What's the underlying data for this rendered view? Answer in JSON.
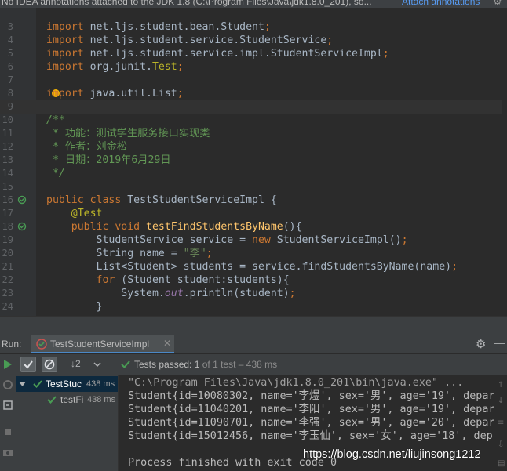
{
  "notification": {
    "message": "No IDEA annotations attached to the JDK 1.8 (C:\\Program Files\\Java\\jdk1.8.0_201), so...",
    "link": "Attach annotations"
  },
  "editor": {
    "lines": [
      {
        "num": "3",
        "current": false,
        "parts": [
          {
            "t": "import",
            "c": "kw"
          },
          {
            "t": " net.ljs.student.bean.Student"
          },
          {
            "t": ";",
            "c": "kw"
          }
        ]
      },
      {
        "num": "4",
        "current": false,
        "parts": [
          {
            "t": "import",
            "c": "kw"
          },
          {
            "t": " net.ljs.student.service.StudentService"
          },
          {
            "t": ";",
            "c": "kw"
          }
        ]
      },
      {
        "num": "5",
        "current": false,
        "parts": [
          {
            "t": "import",
            "c": "kw"
          },
          {
            "t": " net.ljs.student.service.impl.StudentServiceImpl"
          },
          {
            "t": ";",
            "c": "kw"
          }
        ]
      },
      {
        "num": "6",
        "current": false,
        "parts": [
          {
            "t": "import",
            "c": "kw"
          },
          {
            "t": " org.junit."
          },
          {
            "t": "Test",
            "c": "ann"
          },
          {
            "t": ";",
            "c": "kw"
          }
        ]
      },
      {
        "num": "7",
        "current": false,
        "parts": []
      },
      {
        "num": "8",
        "current": false,
        "bulb": true,
        "parts": [
          {
            "t": "import",
            "c": "kw"
          },
          {
            "t": " java.util.List"
          },
          {
            "t": ";",
            "c": "kw"
          }
        ]
      },
      {
        "num": "9",
        "current": true,
        "parts": []
      },
      {
        "num": "10",
        "current": false,
        "parts": [
          {
            "t": "/**",
            "c": "cm"
          }
        ]
      },
      {
        "num": "11",
        "current": false,
        "parts": [
          {
            "t": " * 功能：测试学生服务接口实现类",
            "c": "cmz"
          }
        ]
      },
      {
        "num": "12",
        "current": false,
        "parts": [
          {
            "t": " * 作者：刘金松",
            "c": "cmz"
          }
        ]
      },
      {
        "num": "13",
        "current": false,
        "parts": [
          {
            "t": " * 日期：2019年6月29日",
            "c": "cmz"
          }
        ]
      },
      {
        "num": "14",
        "current": false,
        "parts": [
          {
            "t": " */",
            "c": "cm"
          }
        ]
      },
      {
        "num": "15",
        "current": false,
        "parts": []
      },
      {
        "num": "16",
        "current": false,
        "runIcon": true,
        "parts": [
          {
            "t": "public class ",
            "c": "kw"
          },
          {
            "t": "TestStudentServiceImpl {"
          }
        ]
      },
      {
        "num": "17",
        "current": false,
        "parts": [
          {
            "t": "    "
          },
          {
            "t": "@Test",
            "c": "ann"
          }
        ]
      },
      {
        "num": "18",
        "current": false,
        "runIcon": true,
        "parts": [
          {
            "t": "    "
          },
          {
            "t": "public void ",
            "c": "kw"
          },
          {
            "t": "testFindStudentsByName",
            "c": "fn"
          },
          {
            "t": "(){"
          }
        ]
      },
      {
        "num": "19",
        "current": false,
        "parts": [
          {
            "t": "        StudentService service = "
          },
          {
            "t": "new ",
            "c": "kw"
          },
          {
            "t": "StudentServiceImpl()"
          },
          {
            "t": ";",
            "c": "kw"
          }
        ]
      },
      {
        "num": "20",
        "current": false,
        "parts": [
          {
            "t": "        String name = "
          },
          {
            "t": "\"李\"",
            "c": "str"
          },
          {
            "t": ";",
            "c": "kw"
          }
        ]
      },
      {
        "num": "21",
        "current": false,
        "parts": [
          {
            "t": "        List<Student> students = service.findStudentsByName(name)"
          },
          {
            "t": ";",
            "c": "kw"
          }
        ]
      },
      {
        "num": "22",
        "current": false,
        "parts": [
          {
            "t": "        "
          },
          {
            "t": "for ",
            "c": "kw"
          },
          {
            "t": "(Student student:students){"
          }
        ]
      },
      {
        "num": "23",
        "current": false,
        "parts": [
          {
            "t": "            System."
          },
          {
            "t": "out",
            "c": "fld"
          },
          {
            "t": ".println(student)"
          },
          {
            "t": ";",
            "c": "kw"
          }
        ]
      },
      {
        "num": "24",
        "current": false,
        "parts": [
          {
            "t": "        }"
          }
        ]
      }
    ]
  },
  "run": {
    "label": "Run:",
    "tab_label": "TestStudentServiceImpl",
    "status_prefix": "Tests passed:",
    "status_count": "1",
    "status_suffix": "of 1 test – 438 ms",
    "sort_label": "↓2"
  },
  "tree": {
    "items": [
      {
        "label": "TestStuc",
        "time": "438 ms",
        "selected": true
      },
      {
        "label": "testFi",
        "time": "438 ms",
        "selected": false
      }
    ]
  },
  "console": {
    "lines": [
      {
        "text": "\"C:\\Program Files\\Java\\jdk1.8.0_201\\bin\\java.exe\" ...",
        "gray": true
      },
      {
        "text": "Student{id=10080302, name='李煜', sex='男', age='19', depar",
        "gray": false
      },
      {
        "text": "Student{id=11040201, name='李阳', sex='男', age='19', depar",
        "gray": false
      },
      {
        "text": "Student{id=11090701, name='李强', sex='男', age='20', depar",
        "gray": false
      },
      {
        "text": "Student{id=15012456, name='李玉仙', sex='女', age='18', dep",
        "gray": false
      },
      {
        "text": "",
        "gray": false
      },
      {
        "text": "Process finished with exit code 0",
        "gray": false
      }
    ]
  },
  "watermark": "https://blog.csdn.net/liujinsong1212",
  "colors": {
    "accent": "#4a88c7",
    "success": "#499c54",
    "keyword": "#cc7832",
    "comment": "#629755"
  }
}
